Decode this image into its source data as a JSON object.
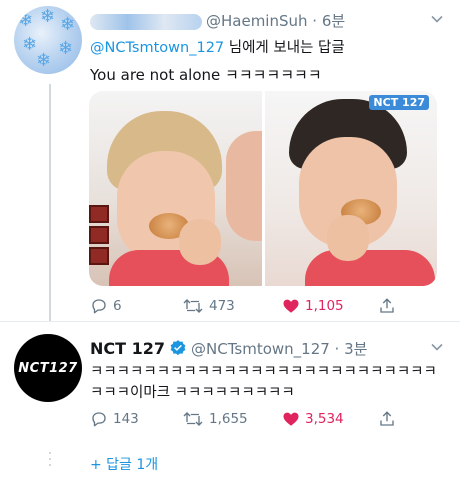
{
  "tweet1": {
    "handle": "@HaeminSuh",
    "time": "6분",
    "reply_to_mention": "@NCTsmtown_127",
    "reply_to_suffix": " 님에게 보내는 답글",
    "text": "You are not alone ㅋㅋㅋㅋㅋㅋㅋ",
    "replies": "6",
    "retweets": "473",
    "likes": "1,105",
    "media_logo": "NCT 127"
  },
  "tweet2": {
    "name": "NCT 127",
    "handle": "@NCTsmtown_127",
    "time": "3분",
    "text": "ㅋㅋㅋㅋㅋㅋㅋㅋㅋㅋㅋㅋㅋㅋㅋㅋㅋㅋㅋㅋㅋㅋㅋㅋㅋㅋㅋㅋㅋ이마크 ㅋㅋㅋㅋㅋㅋㅋㅋㅋ",
    "avatar_text": "NCT127",
    "replies": "143",
    "retweets": "1,655",
    "likes": "3,534"
  },
  "more_replies": "+ 답글 1개",
  "icons": [
    "reply-icon",
    "retweet-icon",
    "heart-icon",
    "share-icon",
    "chevron-down-icon",
    "verified-badge-icon"
  ],
  "colors": {
    "accent": "#1b95e0",
    "like": "#e0245e",
    "muted": "#657786"
  }
}
